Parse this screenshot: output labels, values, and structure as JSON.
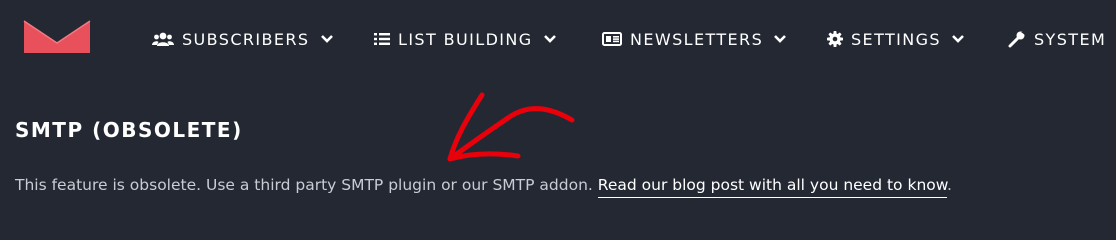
{
  "colors": {
    "background": "#232833",
    "logo": "#e8505b",
    "annotation_arrow": "#e8000b"
  },
  "nav": {
    "logo_icon": "envelope-logo-icon",
    "items": [
      {
        "label": "SUBSCRIBERS",
        "icon": "users-icon",
        "has_dropdown": true
      },
      {
        "label": "LIST BUILDING",
        "icon": "list-icon",
        "has_dropdown": true
      },
      {
        "label": "NEWSLETTERS",
        "icon": "newspaper-icon",
        "has_dropdown": true
      },
      {
        "label": "SETTINGS",
        "icon": "gear-icon",
        "has_dropdown": true
      },
      {
        "label": "SYSTEM",
        "icon": "wrench-icon",
        "has_dropdown": false
      }
    ]
  },
  "main": {
    "title": "SMTP (OBSOLETE)",
    "description": "This feature is obsolete. Use a third party SMTP plugin or our SMTP addon.",
    "link_text": "Read our blog post with all you need to know",
    "trailing": "."
  }
}
